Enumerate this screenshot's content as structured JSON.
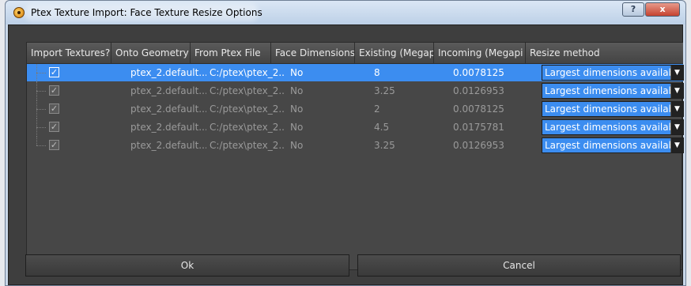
{
  "window": {
    "title": "Ptex Texture Import: Face Texture Resize Options",
    "help_label": "?",
    "close_label": "x"
  },
  "table": {
    "columns": [
      "Import Textures?",
      "Onto Geometry",
      "From Ptex File",
      "Face Dimensions",
      "Existing (Megapi",
      "Incoming (Megapi",
      "Resize method"
    ],
    "rows": [
      {
        "checked": "✓",
        "geometry": "ptex_2.default....",
        "file": "C:/ptex\\ptex_2...",
        "face_dimensions": "No",
        "existing": "8",
        "incoming": "0.0078125",
        "resize": "Largest dimensions available p"
      },
      {
        "checked": "✓",
        "geometry": "ptex_2.default....",
        "file": "C:/ptex\\ptex_2...",
        "face_dimensions": "No",
        "existing": "3.25",
        "incoming": "0.0126953",
        "resize": "Largest dimensions available p"
      },
      {
        "checked": "✓",
        "geometry": "ptex_2.default....",
        "file": "C:/ptex\\ptex_2...",
        "face_dimensions": "No",
        "existing": "2",
        "incoming": "0.0078125",
        "resize": "Largest dimensions available p"
      },
      {
        "checked": "✓",
        "geometry": "ptex_2.default....",
        "file": "C:/ptex\\ptex_2...",
        "face_dimensions": "No",
        "existing": "4.5",
        "incoming": "0.0175781",
        "resize": "Largest dimensions available p"
      },
      {
        "checked": "✓",
        "geometry": "ptex_2.default....",
        "file": "C:/ptex\\ptex_2...",
        "face_dimensions": "No",
        "existing": "3.25",
        "incoming": "0.0126953",
        "resize": "Largest dimensions available p"
      }
    ],
    "selected_row": 0
  },
  "buttons": {
    "ok_label": "Ok",
    "cancel_label": "Cancel"
  },
  "colors": {
    "selection": "#3c8df0",
    "background": "#3e3e3e"
  },
  "icons": {
    "app": "ptex-app-icon",
    "dropdown": "chevron-down-icon",
    "check": "checkmark-icon"
  }
}
